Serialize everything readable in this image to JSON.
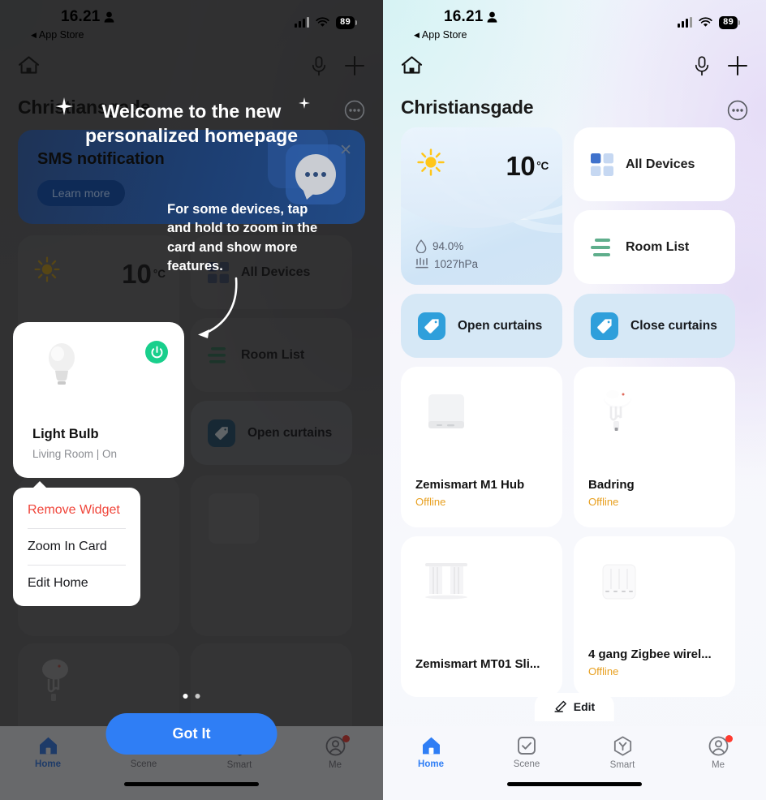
{
  "status_bar": {
    "time": "16.21",
    "back_label": "App Store",
    "battery": "89",
    "person_icon": "person-icon",
    "signal_icon": "cellular-bars-icon",
    "wifi_icon": "wifi-icon"
  },
  "nav": {
    "home_icon": "home-outline-icon",
    "mic_icon": "microphone-icon",
    "add_icon": "plus-icon",
    "more_icon": "more-dots-icon"
  },
  "home": {
    "title": "Christiansgade"
  },
  "weather": {
    "temperature": "10",
    "unit": "°C",
    "humidity": "94.0%",
    "pressure": "1027hPa",
    "sun_icon": "sun-icon",
    "humidity_icon": "droplet-icon",
    "pressure_icon": "barometer-icon"
  },
  "tiles": [
    {
      "label": "All Devices",
      "icon": "grid-squares-icon"
    },
    {
      "label": "Room List",
      "icon": "list-lines-icon"
    }
  ],
  "scenes": [
    {
      "label": "Open curtains",
      "icon": "tag-icon"
    },
    {
      "label": "Close curtains",
      "icon": "tag-icon"
    }
  ],
  "devices": [
    {
      "name": "Zemismart M1 Hub",
      "status": "Offline",
      "icon": "hub-square-icon"
    },
    {
      "name": "Badring",
      "status": "Offline",
      "icon": "water-sensor-icon"
    },
    {
      "name": "Zemismart MT01 Sli...",
      "status": "",
      "icon": "curtain-icon"
    },
    {
      "name": "4 gang Zigbee wirel...",
      "status": "Offline",
      "icon": "gang-switch-icon"
    }
  ],
  "edit_button": {
    "label": "Edit",
    "icon": "pencil-icon"
  },
  "tabbar": {
    "items": [
      {
        "label": "Home",
        "icon": "home-filled-icon",
        "active": true,
        "badge": false
      },
      {
        "label": "Scene",
        "icon": "check-square-icon",
        "active": false,
        "badge": false
      },
      {
        "label": "Smart",
        "icon": "hexagon-y-icon",
        "active": false,
        "badge": false
      },
      {
        "label": "Me",
        "icon": "account-icon",
        "active": false,
        "badge": true
      }
    ]
  },
  "promo": {
    "title": "SMS notification",
    "button": "Learn more",
    "close_icon": "close-icon",
    "art_icon": "chat-bubble-icon"
  },
  "onboarding": {
    "headline": "Welcome to the new personalized homepage",
    "body": "For some devices, tap and hold to zoom in the card and show more features.",
    "cta": "Got It",
    "sparkle_icon": "sparkle-icon",
    "arrow_icon": "curved-arrow-icon"
  },
  "light_widget": {
    "name": "Light Bulb",
    "subtitle": "Living Room | On",
    "bulb_icon": "light-bulb-icon",
    "power_icon": "power-icon"
  },
  "context_menu": {
    "items": [
      {
        "label": "Remove Widget",
        "danger": true
      },
      {
        "label": "Zoom In Card",
        "danger": false
      },
      {
        "label": "Edit Home",
        "danger": false
      }
    ]
  },
  "colors": {
    "accent_blue": "#2f7ef5",
    "scene_blue": "#2f9fdb",
    "offline_amber": "#e8a020",
    "danger_red": "#f0453a",
    "power_green": "#19cf8c"
  }
}
